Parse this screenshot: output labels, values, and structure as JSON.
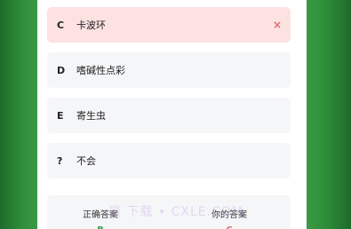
{
  "options": [
    {
      "key": "C",
      "text": "卡波环",
      "state": "wrong"
    },
    {
      "key": "D",
      "text": "嗜碱性点彩",
      "state": "normal"
    },
    {
      "key": "E",
      "text": "寄生虫",
      "state": "normal"
    },
    {
      "key": "?",
      "text": "不会",
      "state": "normal"
    }
  ],
  "wrong_mark": "×",
  "answer_card": {
    "correct_label": "正确答案",
    "correct_value": "B",
    "mine_label": "你的答案",
    "mine_value": "C"
  },
  "watermark": "晨 下载 • CXLE.COM",
  "colors": {
    "background_green": "#2f8f3a",
    "wrong_bg": "#fde2e2",
    "wrong_mark": "#e26b6b",
    "correct_text": "#2e9d46",
    "option_bg": "#f5f6f8"
  }
}
